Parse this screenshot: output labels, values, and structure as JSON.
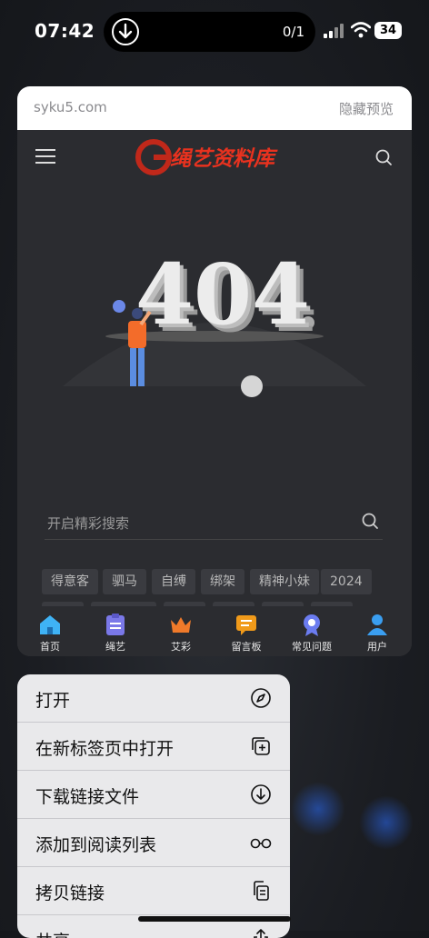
{
  "status_bar": {
    "time": "07:42",
    "download_counter": "0/1",
    "battery": "34"
  },
  "preview": {
    "url": "syku5.com",
    "hide_preview": "隐藏预览",
    "logo_text": "绳艺资料库",
    "error_code": "404",
    "search_placeholder": "开启精彩搜索",
    "tags": [
      "得意客",
      "驷马",
      "自缚",
      "绑架",
      "精神小妹",
      "2024"
    ],
    "tabbar": [
      {
        "label": "首页",
        "icon": "home-icon",
        "color": "#3fb3f5"
      },
      {
        "label": "绳艺",
        "icon": "clipboard-icon",
        "color": "#7a78e8"
      },
      {
        "label": "艾彩",
        "icon": "crown-icon",
        "color": "#f07a2a"
      },
      {
        "label": "留言板",
        "icon": "message-icon",
        "color": "#f09a1a"
      },
      {
        "label": "常见问题",
        "icon": "badge-icon",
        "color": "#6b7cf0"
      },
      {
        "label": "用户",
        "icon": "user-icon",
        "color": "#3a9ef0"
      }
    ]
  },
  "context_menu": {
    "items": [
      {
        "label": "打开",
        "icon": "compass-icon"
      },
      {
        "label": "在新标签页中打开",
        "icon": "new-tab-icon"
      },
      {
        "label": "下载链接文件",
        "icon": "download-icon"
      },
      {
        "label": "添加到阅读列表",
        "icon": "glasses-icon"
      },
      {
        "label": "拷贝链接",
        "icon": "copy-icon"
      },
      {
        "label": "共享…",
        "icon": "share-icon"
      }
    ]
  }
}
